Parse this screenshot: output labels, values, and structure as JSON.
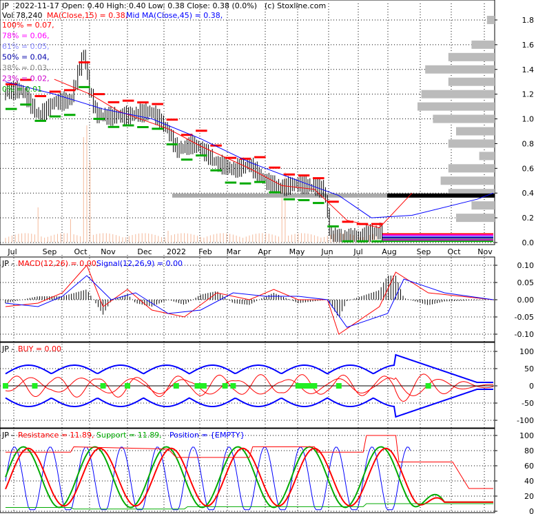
{
  "header": {
    "ticker": "JP",
    "date": "2022-11-17",
    "quote": "Open: 0.40  High: 0.40  Low: 0.38  Close: 0.38 (0.0%)",
    "source": "(c) Stoxline.com",
    "volume_line": "Vol 78,240",
    "ma15_label": "MA(Close,15) = 0.38,",
    "ma45_label": "Mid MA(Close,45) = 0.38,"
  },
  "fib_levels": [
    {
      "label": "100% = 0.07,",
      "color": "#ff0000"
    },
    {
      "label": "78% = 0.06,",
      "color": "#ff00ff"
    },
    {
      "label": "61% = 0.05,",
      "color": "#8888ff"
    },
    {
      "label": "50% = 0.04,",
      "color": "#0000aa"
    },
    {
      "label": "38% = 0.03,",
      "color": "#888888"
    },
    {
      "label": "23% = 0.02,",
      "color": "#cc00cc"
    },
    {
      "label": "0% = 0.01",
      "color": "#00aa00"
    }
  ],
  "colors": {
    "red": "#ff0000",
    "blue": "#0000ff",
    "green": "#00aa00",
    "black": "#000000",
    "gray": "#bbbbbb",
    "volume": "#f4b89a"
  },
  "x_axis_labels": [
    "Jul",
    "Sep",
    "Oct",
    "Nov",
    "Dec",
    "2022",
    "Feb",
    "Mar",
    "Apr",
    "May",
    "Jun",
    "Jul",
    "Aug",
    "Sep",
    "Oct",
    "Nov"
  ],
  "panels": {
    "macd": {
      "prefix": "JP - ",
      "name": "MACD(12,26) = 0.00,",
      "signal": "Signal(12,26,9) = 0.00"
    },
    "buy": {
      "prefix": "JP - ",
      "name": "BUY = 0.00"
    },
    "rsp": {
      "prefix": "JP - ",
      "resistance": "Resistance = 11.89,",
      "support": "Support = 11.89,",
      "position": "Position = {EMPTY}"
    }
  },
  "chart_data": [
    {
      "type": "candlestick",
      "title": "JP  2022-11-17 Open: 0.40  High: 0.40  Low: 0.38  Close: 0.38 (0.0%)",
      "ylim": [
        0,
        1.85
      ],
      "y_ticks": [
        "0.0",
        "0.2",
        "0.4",
        "0.6",
        "0.8",
        "1.0",
        "1.2",
        "1.4",
        "1.6",
        "1.8"
      ],
      "price_path": [
        [
          0,
          1.18
        ],
        [
          10,
          1.22
        ],
        [
          20,
          1.05
        ],
        [
          30,
          1.15
        ],
        [
          40,
          1.12
        ],
        [
          48,
          1.5
        ],
        [
          52,
          1.18
        ],
        [
          56,
          1.02
        ],
        [
          70,
          1.05
        ],
        [
          90,
          1.02
        ],
        [
          100,
          0.88
        ],
        [
          105,
          0.75
        ],
        [
          115,
          0.82
        ],
        [
          120,
          0.78
        ],
        [
          130,
          0.62
        ],
        [
          140,
          0.55
        ],
        [
          150,
          0.62
        ],
        [
          160,
          0.52
        ],
        [
          170,
          0.45
        ],
        [
          178,
          0.45
        ],
        [
          186,
          0.42
        ],
        [
          196,
          0.42
        ],
        [
          200,
          0.04
        ],
        [
          206,
          0.07
        ],
        [
          215,
          0.05
        ],
        [
          222,
          0.05
        ],
        [
          228,
          0.05
        ],
        [
          300,
          0.05
        ]
      ],
      "ma15_path": [
        [
          30,
          1.32
        ],
        [
          52,
          1.2
        ],
        [
          70,
          1.06
        ],
        [
          100,
          0.92
        ],
        [
          120,
          0.78
        ],
        [
          150,
          0.6
        ],
        [
          170,
          0.46
        ],
        [
          190,
          0.43
        ],
        [
          210,
          0.18
        ],
        [
          230,
          0.12
        ],
        [
          250,
          0.4
        ]
      ],
      "ma45_path": [
        [
          0,
          1.3
        ],
        [
          30,
          1.2
        ],
        [
          60,
          1.08
        ],
        [
          90,
          1.0
        ],
        [
          120,
          0.84
        ],
        [
          150,
          0.65
        ],
        [
          180,
          0.5
        ],
        [
          205,
          0.38
        ],
        [
          225,
          0.2
        ],
        [
          250,
          0.22
        ],
        [
          290,
          0.35
        ],
        [
          300,
          0.4
        ]
      ],
      "support_level": 0.38,
      "volume_spikes": [
        [
          20,
          0.3
        ],
        [
          40,
          0.2
        ],
        [
          48,
          0.9
        ],
        [
          50,
          1.0
        ],
        [
          52,
          0.7
        ],
        [
          100,
          0.1
        ],
        [
          170,
          0.5
        ],
        [
          172,
          0.6
        ]
      ],
      "volume_profile_rows": [
        [
          1.8,
          0.1
        ],
        [
          1.6,
          0.3
        ],
        [
          1.5,
          0.6
        ],
        [
          1.4,
          0.9
        ],
        [
          1.3,
          0.6
        ],
        [
          1.2,
          0.95
        ],
        [
          1.1,
          1.0
        ],
        [
          1.0,
          0.8
        ],
        [
          0.9,
          0.5
        ],
        [
          0.8,
          0.6
        ],
        [
          0.7,
          0.2
        ],
        [
          0.6,
          0.6
        ],
        [
          0.5,
          0.7
        ],
        [
          0.4,
          0.6
        ],
        [
          0.3,
          0.3
        ],
        [
          0.2,
          0.5
        ]
      ]
    },
    {
      "type": "line",
      "title": "MACD(12,26) = 0.00, Signal(12,26,9) = 0.00",
      "ylim": [
        -0.12,
        0.12
      ],
      "y_ticks": [
        "0.10",
        "0.05",
        "0.00",
        "-0.05",
        "-0.10"
      ],
      "series": [
        {
          "name": "MACD(12,26)",
          "values": [
            [
              0,
              -0.02
            ],
            [
              20,
              -0.01
            ],
            [
              35,
              0.02
            ],
            [
              50,
              0.1
            ],
            [
              60,
              -0.02
            ],
            [
              75,
              0.03
            ],
            [
              90,
              -0.03
            ],
            [
              110,
              -0.05
            ],
            [
              130,
              0.02
            ],
            [
              150,
              0.0
            ],
            [
              165,
              0.03
            ],
            [
              180,
              0.0
            ],
            [
              198,
              0.0
            ],
            [
              205,
              -0.1
            ],
            [
              230,
              -0.02
            ],
            [
              240,
              0.08
            ],
            [
              260,
              0.02
            ],
            [
              300,
              0.0
            ]
          ]
        },
        {
          "name": "Signal(12,26,9)",
          "values": [
            [
              0,
              -0.01
            ],
            [
              20,
              -0.02
            ],
            [
              35,
              0.01
            ],
            [
              50,
              0.07
            ],
            [
              65,
              0.0
            ],
            [
              80,
              0.02
            ],
            [
              100,
              -0.04
            ],
            [
              120,
              -0.03
            ],
            [
              140,
              0.02
            ],
            [
              160,
              0.01
            ],
            [
              180,
              0.01
            ],
            [
              198,
              0.0
            ],
            [
              210,
              -0.08
            ],
            [
              235,
              -0.04
            ],
            [
              245,
              0.06
            ],
            [
              270,
              0.02
            ],
            [
              300,
              0.0
            ]
          ]
        }
      ]
    },
    {
      "type": "line",
      "title": "BUY = 0.00",
      "ylim": [
        -120,
        120
      ],
      "y_ticks": [
        "100",
        "50",
        "0",
        "-50",
        "-100"
      ],
      "series": [
        {
          "name": "BUY",
          "values": [
            [
              0,
              0
            ],
            [
              300,
              0
            ]
          ]
        }
      ],
      "buy_markers": [
        0,
        18,
        60,
        75,
        105,
        118,
        120,
        122,
        135,
        140,
        180,
        182,
        185,
        188,
        190,
        205,
        260
      ]
    },
    {
      "type": "line",
      "title": "Resistance = 11.89, Support = 11.89, Position = {EMPTY}",
      "ylim": [
        0,
        100
      ],
      "y_ticks": [
        "100",
        "80",
        "60",
        "40",
        "20",
        "0"
      ],
      "series": [
        {
          "name": "Resistance",
          "values": [
            [
              0,
              78
            ],
            [
              40,
              78
            ],
            [
              42,
              85
            ],
            [
              100,
              82
            ],
            [
              105,
              71
            ],
            [
              150,
              71
            ],
            [
              152,
              85
            ],
            [
              190,
              85
            ],
            [
              192,
              78
            ],
            [
              220,
              78
            ],
            [
              222,
              100
            ],
            [
              240,
              100
            ],
            [
              242,
              65
            ],
            [
              275,
              65
            ],
            [
              285,
              30
            ],
            [
              300,
              30
            ]
          ]
        },
        {
          "name": "Support",
          "values": [
            [
              0,
              5
            ],
            [
              40,
              5
            ],
            [
              42,
              3
            ],
            [
              110,
              3
            ],
            [
              112,
              6
            ],
            [
              220,
              6
            ],
            [
              222,
              10
            ],
            [
              270,
              10
            ],
            [
              300,
              10
            ]
          ]
        },
        {
          "name": "Position",
          "values": [
            [
              0,
              30
            ],
            [
              300,
              30
            ]
          ]
        }
      ]
    }
  ]
}
